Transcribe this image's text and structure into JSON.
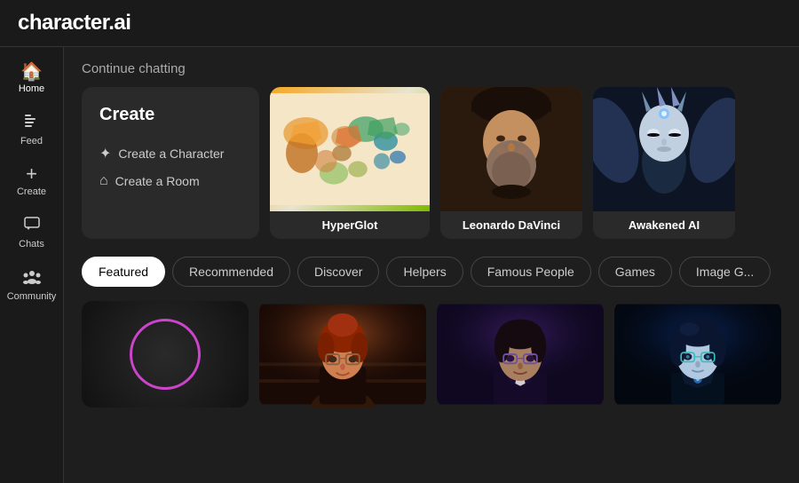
{
  "header": {
    "logo": "character.ai"
  },
  "sidebar": {
    "items": [
      {
        "id": "home",
        "label": "Home",
        "icon": "⌂",
        "active": true
      },
      {
        "id": "feed",
        "label": "Feed",
        "icon": "☰"
      },
      {
        "id": "create",
        "label": "Create",
        "icon": "+"
      },
      {
        "id": "chats",
        "label": "Chats",
        "icon": "💬"
      },
      {
        "id": "community",
        "label": "Community",
        "icon": "👥"
      }
    ]
  },
  "content": {
    "continue_chatting": "Continue chatting",
    "create_card": {
      "title": "Create",
      "options": [
        {
          "id": "create-character",
          "icon": "✦",
          "label": "Create a Character"
        },
        {
          "id": "create-room",
          "icon": "⌂",
          "label": "Create a Room"
        }
      ]
    },
    "chat_cards": [
      {
        "id": "hyperglot",
        "name": "HyperGlot",
        "type": "worldmap"
      },
      {
        "id": "davinci",
        "name": "Leonardo DaVinci",
        "type": "davinci"
      },
      {
        "id": "awakened",
        "name": "Awakened AI",
        "type": "ai"
      }
    ],
    "tabs": [
      {
        "id": "featured",
        "label": "Featured",
        "active": true
      },
      {
        "id": "recommended",
        "label": "Recommended",
        "active": false
      },
      {
        "id": "discover",
        "label": "Discover",
        "active": false
      },
      {
        "id": "helpers",
        "label": "Helpers",
        "active": false
      },
      {
        "id": "famous-people",
        "label": "Famous People",
        "active": false
      },
      {
        "id": "games",
        "label": "Games",
        "active": false
      },
      {
        "id": "image-gen",
        "label": "Image G...",
        "active": false
      }
    ],
    "bottom_cards": [
      {
        "id": "circle-char",
        "type": "circle"
      },
      {
        "id": "redhead-char",
        "type": "redhead"
      },
      {
        "id": "purple-char",
        "type": "purple"
      },
      {
        "id": "blue-char",
        "type": "blue"
      }
    ]
  }
}
